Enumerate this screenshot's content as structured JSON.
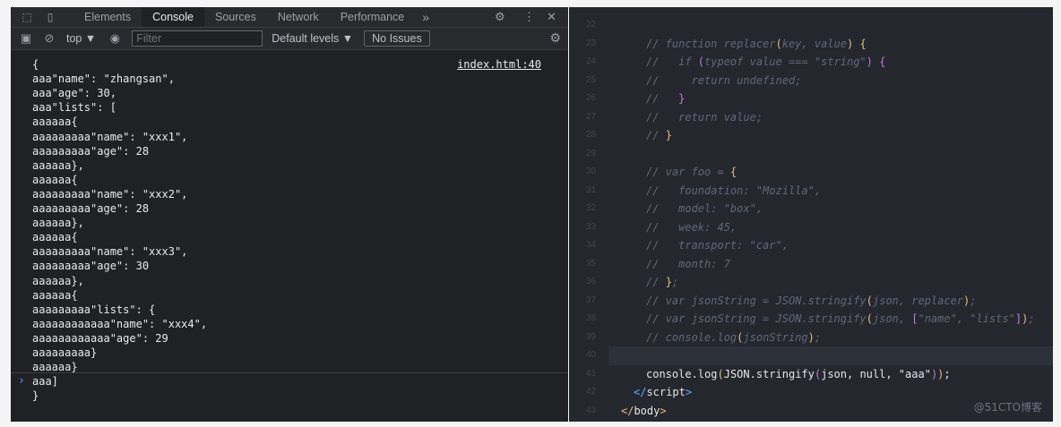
{
  "devtools": {
    "tabs": [
      {
        "label": "Elements",
        "active": false
      },
      {
        "label": "Console",
        "active": true
      },
      {
        "label": "Sources",
        "active": false
      },
      {
        "label": "Network",
        "active": false
      },
      {
        "label": "Performance",
        "active": false
      }
    ],
    "more_tabs": "»",
    "toolbar": {
      "context": "top ▼",
      "filter_placeholder": "Filter",
      "levels": "Default levels ▼",
      "issues": "No Issues"
    },
    "console": {
      "source_link": "index.html:40",
      "lines": [
        "{",
        "aaa\"name\": \"zhangsan\",",
        "aaa\"age\": 30,",
        "aaa\"lists\": [",
        "aaaaaa{",
        "aaaaaaaaa\"name\": \"xxx1\",",
        "aaaaaaaaa\"age\": 28",
        "aaaaaa},",
        "aaaaaa{",
        "aaaaaaaaa\"name\": \"xxx2\",",
        "aaaaaaaaa\"age\": 28",
        "aaaaaa},",
        "aaaaaa{",
        "aaaaaaaaa\"name\": \"xxx3\",",
        "aaaaaaaaa\"age\": 30",
        "aaaaaa},",
        "aaaaaa{",
        "aaaaaaaaa\"lists\": {",
        "aaaaaaaaaaaa\"name\": \"xxx4\",",
        "aaaaaaaaaaaa\"age\": 29",
        "aaaaaaaaa}",
        "aaaaaa}",
        "aaa]",
        "}"
      ],
      "prompt": "›"
    }
  },
  "editor": {
    "line_numbers": [
      "22",
      "23",
      "24",
      "25",
      "26",
      "27",
      "28",
      "29",
      "30",
      "31",
      "32",
      "33",
      "34",
      "35",
      "36",
      "37",
      "38",
      "39",
      "40",
      "41",
      "42",
      "43"
    ],
    "watermark": "@51CTO博客"
  },
  "icons": {
    "inspect": "inspect-element-icon",
    "device": "device-toolbar-icon",
    "settings": "gear-icon",
    "menu": "kebab-menu-icon",
    "close": "close-icon",
    "sidebar": "sidebar-toggle-icon",
    "clear": "clear-console-icon",
    "eye": "eye-icon"
  },
  "colors": {
    "devtools_bg": "#202124",
    "editor_bg": "#24272e",
    "comment": "#5f6878",
    "bracket_yellow": "#e5c07b",
    "bracket_purple": "#c678dd",
    "tag_blue": "#61afef",
    "prompt_blue": "#4e9bf4"
  }
}
